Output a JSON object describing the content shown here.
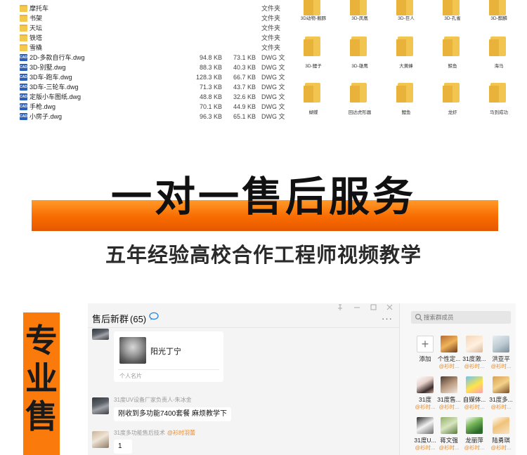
{
  "explorer": {
    "files": [
      {
        "name": "摩托车",
        "size": "",
        "compressed": "",
        "type": "文件夹",
        "kind": "folder"
      },
      {
        "name": "书架",
        "size": "",
        "compressed": "",
        "type": "文件夹",
        "kind": "folder"
      },
      {
        "name": "天坛",
        "size": "",
        "compressed": "",
        "type": "文件夹",
        "kind": "folder"
      },
      {
        "name": "铁塔",
        "size": "",
        "compressed": "",
        "type": "文件夹",
        "kind": "folder"
      },
      {
        "name": "雪橇",
        "size": "",
        "compressed": "",
        "type": "文件夹",
        "kind": "folder"
      },
      {
        "name": "2D-多款自行车.dwg",
        "size": "94.8 KB",
        "compressed": "73.1 KB",
        "type": "DWG 文",
        "kind": "cad"
      },
      {
        "name": "3D-别墅.dwg",
        "size": "88.3 KB",
        "compressed": "40.3 KB",
        "type": "DWG 文",
        "kind": "cad"
      },
      {
        "name": "3D车-跑车.dwg",
        "size": "128.3 KB",
        "compressed": "66.7 KB",
        "type": "DWG 文",
        "kind": "cad"
      },
      {
        "name": "3D车-三轮车.dwg",
        "size": "71.3 KB",
        "compressed": "43.7 KB",
        "type": "DWG 文",
        "kind": "cad"
      },
      {
        "name": "定版小车图纸.dwg",
        "size": "48.8 KB",
        "compressed": "32.6 KB",
        "type": "DWG 文",
        "kind": "cad"
      },
      {
        "name": "手枪.dwg",
        "size": "70.1 KB",
        "compressed": "44.9 KB",
        "type": "DWG 文",
        "kind": "cad"
      },
      {
        "name": "小房子.dwg",
        "size": "96.3 KB",
        "compressed": "65.1 KB",
        "type": "DWG 文",
        "kind": "cad"
      }
    ],
    "folders": [
      "3D动物-靓豚",
      "3D-凤凰",
      "3D-巨人",
      "3D-孔雀",
      "3D-麒麟",
      "3D-鲤子",
      "3D-雄鹰",
      "大黄蜂",
      "鲸鱼",
      "海马",
      "蝴蝶",
      "回达虎形器",
      "鲤鱼",
      "龙虾",
      "马到成功"
    ]
  },
  "banner": {
    "title": "一对一售后服务",
    "subtitle": "五年经验高校合作工程师视频教学",
    "side_title": "专业售"
  },
  "chat": {
    "group_title": "售后新群",
    "member_count": "(65)",
    "more": "···",
    "card_name": "阳光丁宁",
    "card_caption": "个人名片",
    "messages": [
      {
        "sender": "31度UV设备厂家负责人-朱冰金",
        "tag": "",
        "text": "刚收到多功能7400套餐   麻烦教学下"
      },
      {
        "sender": "31度多功能售后技术",
        "tag": "@衫时羽蕾",
        "text": "1"
      }
    ]
  },
  "members": {
    "search_placeholder": "搜索群成员",
    "add_label": "添加",
    "list": [
      {
        "name": "个性定...",
        "tag": "@衫时..."
      },
      {
        "name": "31度激...",
        "tag": "@衫时..."
      },
      {
        "name": "洪亚平",
        "tag": "@衫时..."
      },
      {
        "name": "31度",
        "tag": "@衫时..."
      },
      {
        "name": "31度售...",
        "tag": "@衫时..."
      },
      {
        "name": "自媒体...",
        "tag": "@衫时..."
      },
      {
        "name": "31度多...",
        "tag": "@衫时..."
      },
      {
        "name": "31度U...",
        "tag": "@衫时..."
      },
      {
        "name": "蒋文强",
        "tag": "@衫时..."
      },
      {
        "name": "龙丽萍",
        "tag": "@衫时..."
      },
      {
        "name": "陆勇琪",
        "tag": "@衫时..."
      }
    ]
  },
  "colors": {
    "accent_orange": "#f86b00",
    "tag_orange": "#e8892b",
    "folder_yellow": "#f2c450"
  }
}
